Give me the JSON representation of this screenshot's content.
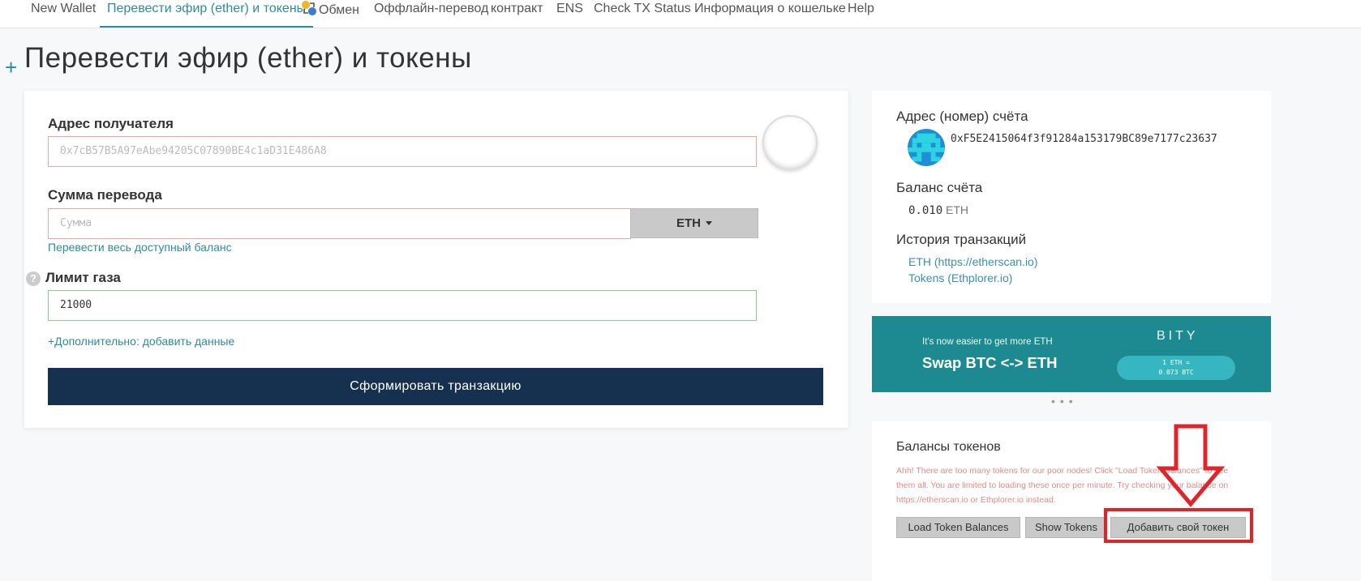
{
  "nav": {
    "items": [
      "New Wallet",
      "Перевести эфир (ether) и токены",
      "Обмен",
      "Оффлайн-перевод",
      "контракт",
      "ENS",
      "Check TX Status",
      "Информация о кошельке",
      "Help"
    ],
    "active_index": 1
  },
  "page": {
    "plus": "+",
    "title": "Перевести эфир (ether) и токены"
  },
  "form": {
    "recipient_label": "Адрес получателя",
    "recipient_placeholder": "0x7cB57B5A97eAbe94205C07890BE4c1aD31E486A8",
    "amount_label": "Сумма перевода",
    "amount_placeholder": "Сумма",
    "currency": "ETH",
    "send_all_link": "Перевести весь доступный баланс",
    "gas_help": "?",
    "gas_label": "Лимит газа",
    "gas_value": "21000",
    "advanced_link": "+Дополнительно: добавить данные",
    "submit_label": "Сформировать транзакцию"
  },
  "account": {
    "address_label": "Адрес (номер) счёта",
    "address": "0xF5E2415064f3f91284a153179BC89e7177c23637",
    "balance_label": "Баланс счёта",
    "balance_value": "0.010",
    "balance_unit": "ETH",
    "history_label": "История транзакций",
    "history_eth": "ETH (https://etherscan.io)",
    "history_tokens": "Tokens (Ethplorer.io)"
  },
  "banner": {
    "tagline": "It's now easier to get more ETH",
    "headline": "Swap BTC <-> ETH",
    "brand": "BITY",
    "rate_line1": "1 ETH =",
    "rate_line2": "0.073 BTC",
    "dots": "•••",
    "colors": {
      "background": "#1d8a91",
      "pill": "#35b6c0"
    }
  },
  "tokens": {
    "title": "Балансы токенов",
    "warning": "Ahh! There are too many tokens for our poor nodes! Click \"Load Token Balances\" to see them all. You are limited to loading these once per minute. Try checking your balance on https://etherscan.io or Ethplorer.io instead.",
    "load_button": "Load Token Balances",
    "show_button": "Show Tokens",
    "add_button": "Добавить свой токен"
  },
  "colors": {
    "accent": "#2e8b9a",
    "primary_button": "#163150",
    "annotation": "#e0242a"
  }
}
